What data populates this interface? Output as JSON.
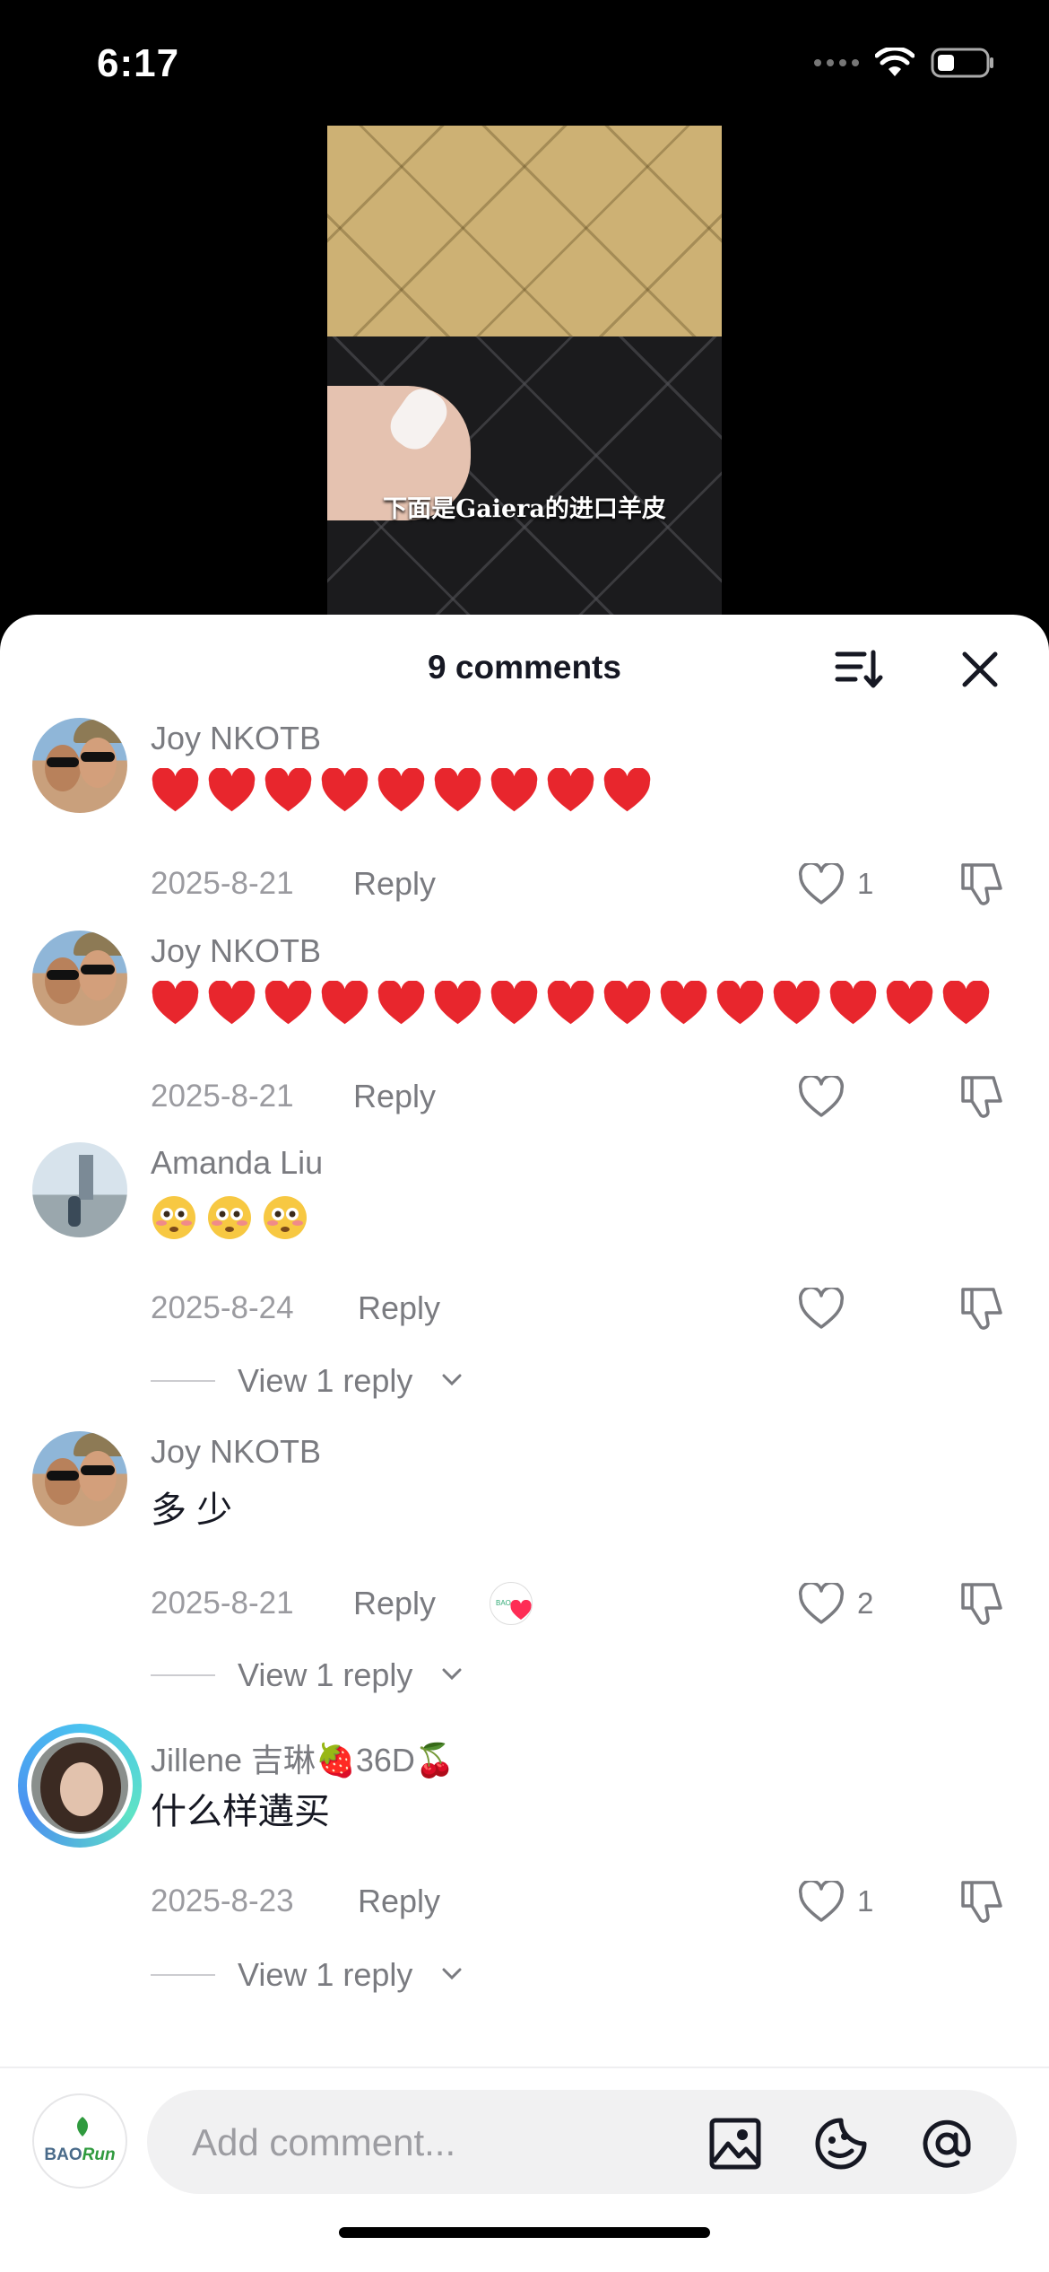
{
  "status_bar": {
    "time": "6:17"
  },
  "video": {
    "caption": "下面是Gaiera的进口羊皮"
  },
  "comments_panel": {
    "title": "9 comments",
    "comments": [
      {
        "author": "Joy NKOTB",
        "content_hearts": 9,
        "date": "2025-8-21",
        "reply_label": "Reply",
        "likes": "1"
      },
      {
        "author": "Joy NKOTB",
        "content_hearts": 15,
        "date": "2025-8-21",
        "reply_label": "Reply",
        "likes": ""
      },
      {
        "author": "Amanda Liu",
        "content_emoji": "😳😳😳",
        "date": "2025-8-24",
        "reply_label": "Reply",
        "likes": "",
        "view_replies": "View 1 reply"
      },
      {
        "author": "Joy NKOTB",
        "text": "多 少",
        "date": "2025-8-21",
        "reply_label": "Reply",
        "likes": "2",
        "view_replies": "View 1 reply"
      },
      {
        "author": "Jillene 吉琳🍓36D🍒",
        "text": "什么样遘买",
        "date": "2025-8-23",
        "reply_label": "Reply",
        "likes": "1",
        "view_replies": "View 1 reply"
      }
    ]
  },
  "composer": {
    "placeholder": "Add comment...",
    "user_logo_text_a": "BAO",
    "user_logo_text_b": "Run"
  },
  "colors": {
    "heart_red": "#e8262d",
    "text_muted": "#7a7b80",
    "sheet_bg": "#ffffff"
  }
}
